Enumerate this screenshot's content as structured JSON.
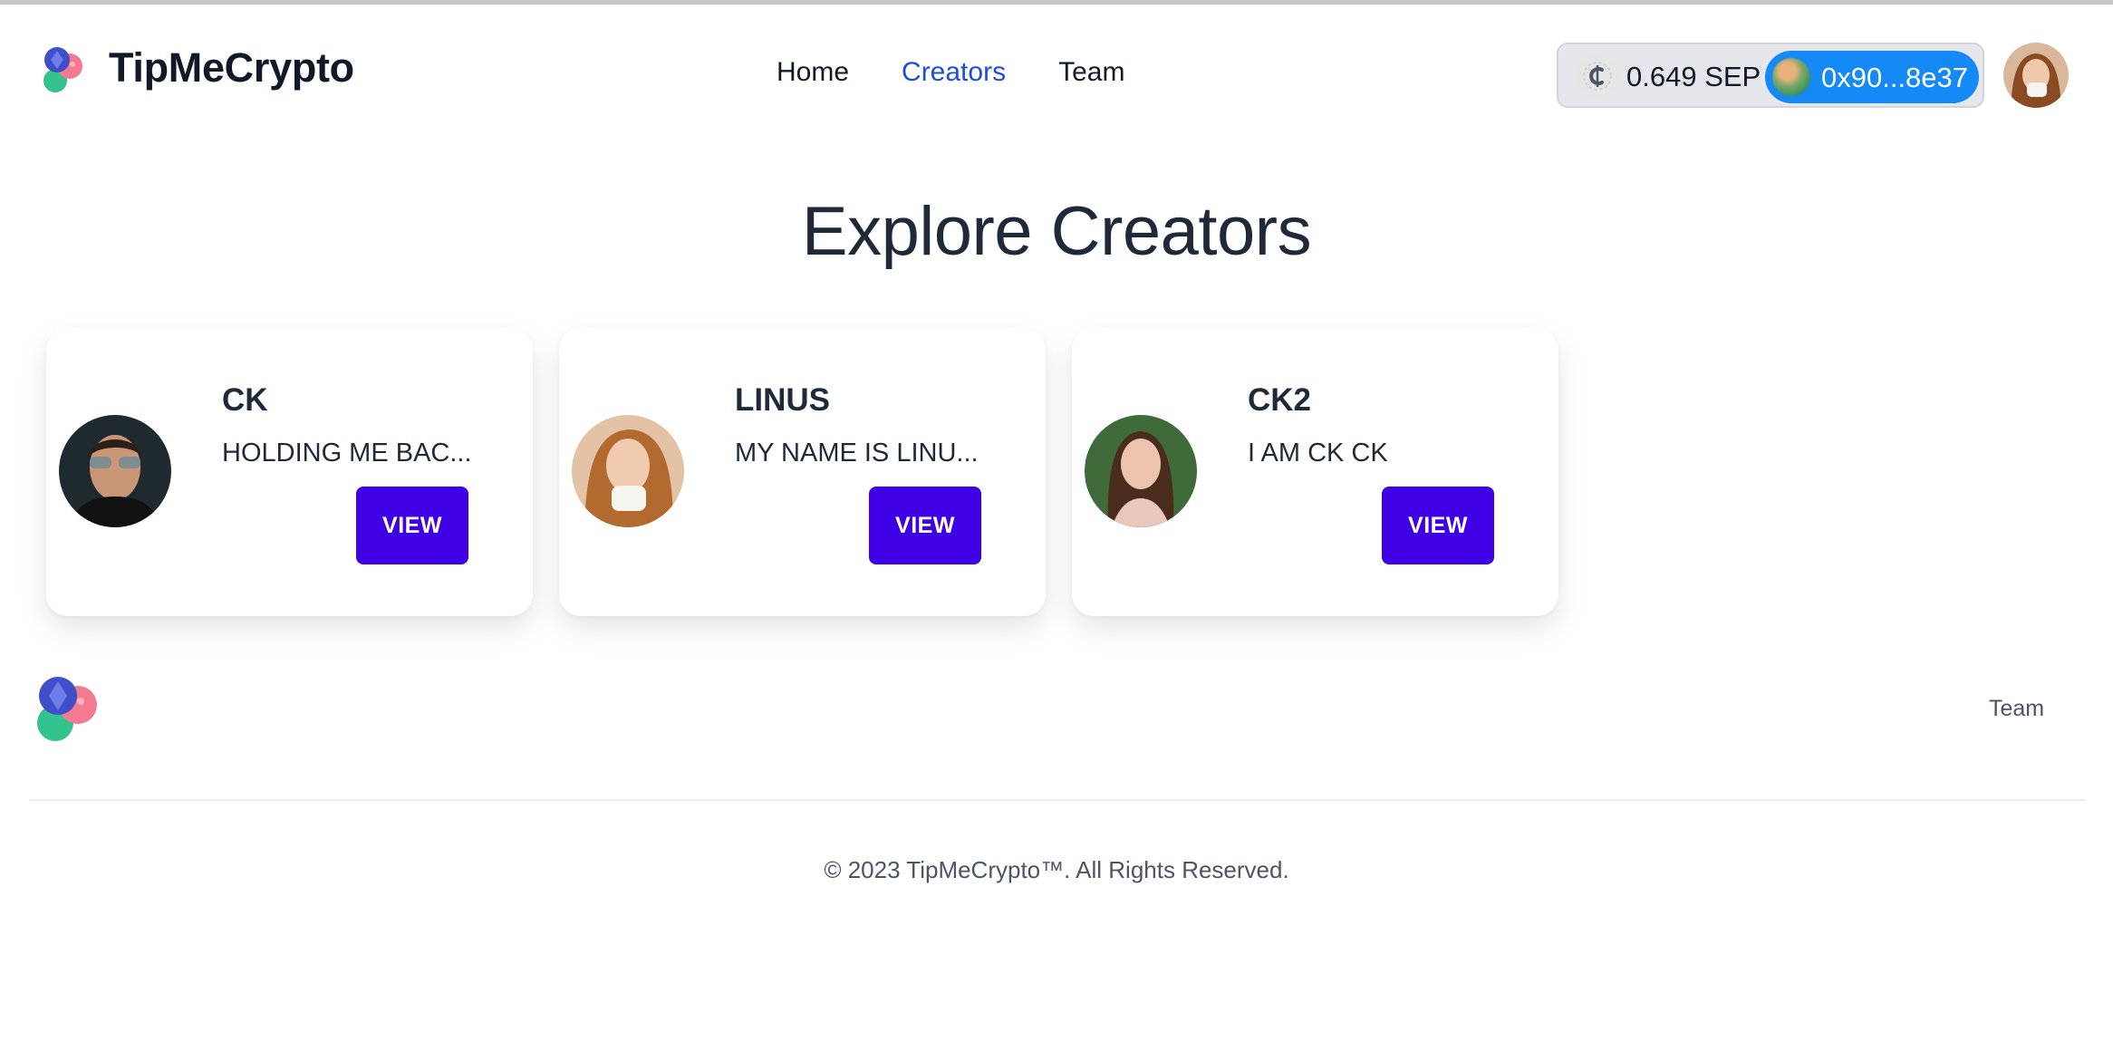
{
  "brand": {
    "name": "TipMeCrypto"
  },
  "nav": [
    {
      "label": "Home",
      "active": false
    },
    {
      "label": "Creators",
      "active": true
    },
    {
      "label": "Team",
      "active": false
    }
  ],
  "wallet": {
    "balance": "0.649 SEP",
    "address": "0x90...8e37",
    "coin_icon": "chainlink-icon"
  },
  "page": {
    "title": "Explore Creators"
  },
  "creators": [
    {
      "name": "CK",
      "description": "HOLDING ME BAC...",
      "button": "VIEW"
    },
    {
      "name": "LINUS",
      "description": "MY NAME IS LINU...",
      "button": "VIEW"
    },
    {
      "name": "CK2",
      "description": "I AM CK CK",
      "button": "VIEW"
    }
  ],
  "footer": {
    "team_link": "Team",
    "copyright": "© 2023 TipMeCrypto™. All Rights Reserved."
  },
  "colors": {
    "accent": "#1d4ed8",
    "button": "#4000e6",
    "wallet_pill": "#1589f5"
  }
}
